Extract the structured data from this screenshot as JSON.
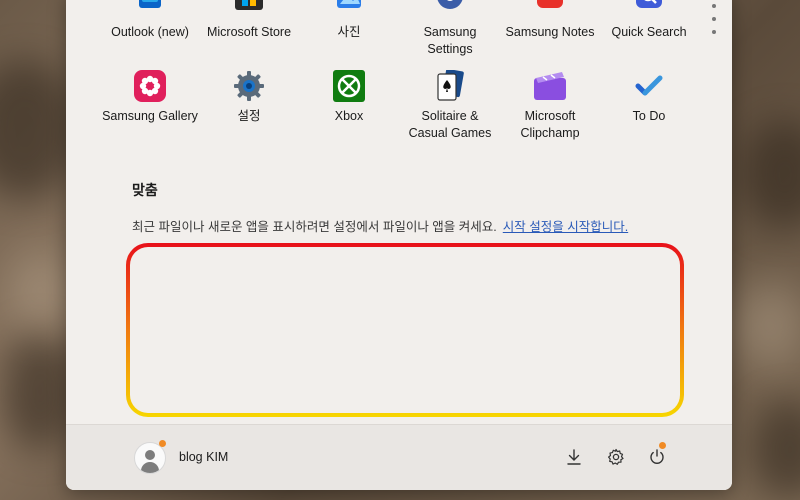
{
  "start_menu": {
    "pinned_apps_row1": [
      {
        "label": "Outlook (new)",
        "icon": "outlook-icon"
      },
      {
        "label": "Microsoft Store",
        "icon": "microsoft-store-icon"
      },
      {
        "label": "사진",
        "icon": "photos-icon"
      },
      {
        "label": "Samsung\nSettings",
        "icon": "samsung-settings-icon"
      },
      {
        "label": "Samsung Notes",
        "icon": "samsung-notes-icon"
      },
      {
        "label": "Quick Search",
        "icon": "quick-search-icon"
      }
    ],
    "pinned_apps_row2": [
      {
        "label": "Samsung Gallery",
        "icon": "samsung-gallery-icon"
      },
      {
        "label": "설정",
        "icon": "settings-icon"
      },
      {
        "label": "Xbox",
        "icon": "xbox-icon"
      },
      {
        "label": "Solitaire &\nCasual Games",
        "icon": "solitaire-icon"
      },
      {
        "label": "Microsoft\nClipchamp",
        "icon": "clipchamp-icon"
      },
      {
        "label": "To Do",
        "icon": "todo-icon"
      }
    ],
    "recommended": {
      "title": "맞춤",
      "message": "최근 파일이나 새로운 앱을 표시하려면 설정에서 파일이나 앱을 켜세요.",
      "link": "시작 설정을 시작합니다."
    },
    "footer": {
      "user_name": "blog KIM",
      "download_icon": "download-icon",
      "settings_icon": "gear-icon",
      "power_icon": "power-icon"
    },
    "colors": {
      "highlight_top": "#e8101a",
      "highlight_bottom": "#f7d600",
      "link": "#2a5ab8",
      "badge": "#f08a24"
    }
  }
}
